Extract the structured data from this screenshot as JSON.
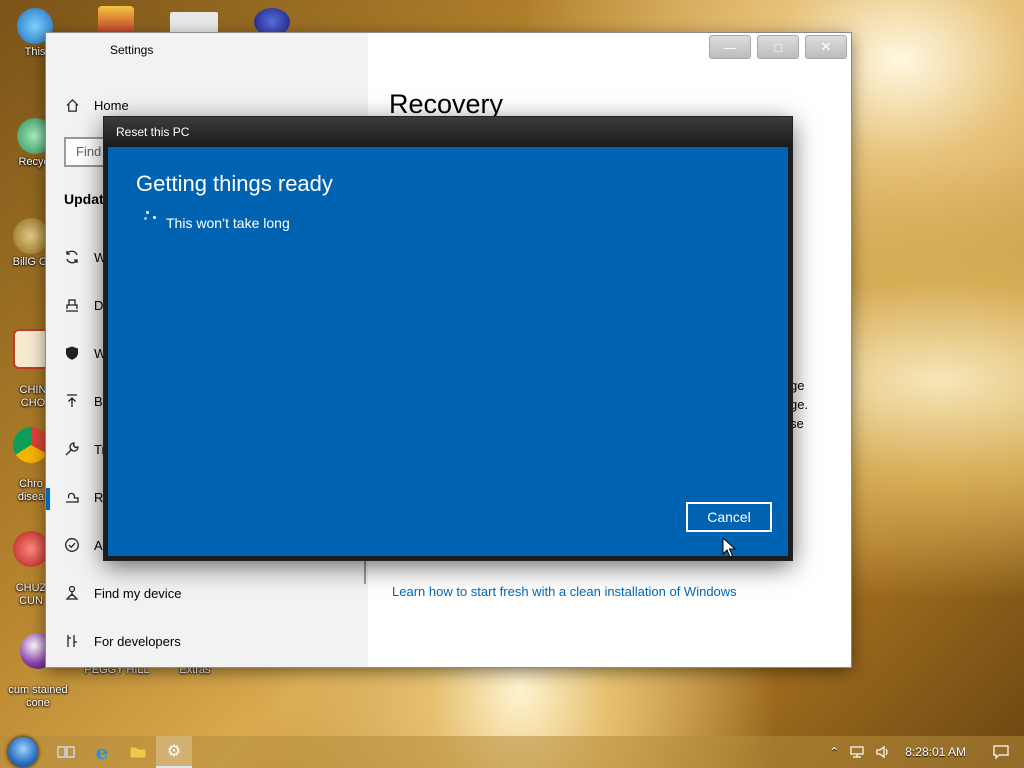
{
  "desktop_icons": [
    {
      "label": "This",
      "color": "#1e90ff"
    },
    {
      "label": "Recycl",
      "color": "#2e8b57"
    },
    {
      "label": "BillG Ci",
      "color": "#8b6914"
    },
    {
      "label": "CHIN\nCHO",
      "color": "#c0392b"
    },
    {
      "label": "Chro\ndisea",
      "color": "#db4437"
    },
    {
      "label": "CHUZ\nCUN",
      "color": "#e74c3c"
    },
    {
      "label": "cum stained\ncone",
      "color": "#8e44ad"
    },
    {
      "label": "PEGGY HILL",
      "color": "#7f5f2a"
    },
    {
      "label": "Extras",
      "color": "#7f5f2a"
    }
  ],
  "settings": {
    "title": "Settings",
    "nav_home": "Home",
    "search_placeholder": "Find",
    "section_heading": "Updat",
    "nav_items": [
      {
        "label": "W",
        "icon": "sync-icon"
      },
      {
        "label": "D",
        "icon": "delivery-icon"
      },
      {
        "label": "W",
        "icon": "shield-icon"
      },
      {
        "label": "B",
        "icon": "backup-icon"
      },
      {
        "label": "Tr",
        "icon": "wrench-icon"
      },
      {
        "label": "R",
        "icon": "recovery-icon"
      },
      {
        "label": "A",
        "icon": "activation-icon"
      },
      {
        "label": "Find my device",
        "icon": "find-device-icon"
      },
      {
        "label": "For developers",
        "icon": "developer-icon"
      }
    ],
    "page_title": "Recovery",
    "right_fragments": [
      "ge",
      "ge.",
      "se"
    ],
    "learn_link": "Learn how to start fresh with a clean installation of Windows"
  },
  "dialog": {
    "title": "Reset this PC",
    "heading": "Getting things ready",
    "subtext": "This won’t take long",
    "cancel_label": "Cancel",
    "bg_color": "#0063b1"
  },
  "taskbar": {
    "clock": "8:28:01 AM"
  }
}
